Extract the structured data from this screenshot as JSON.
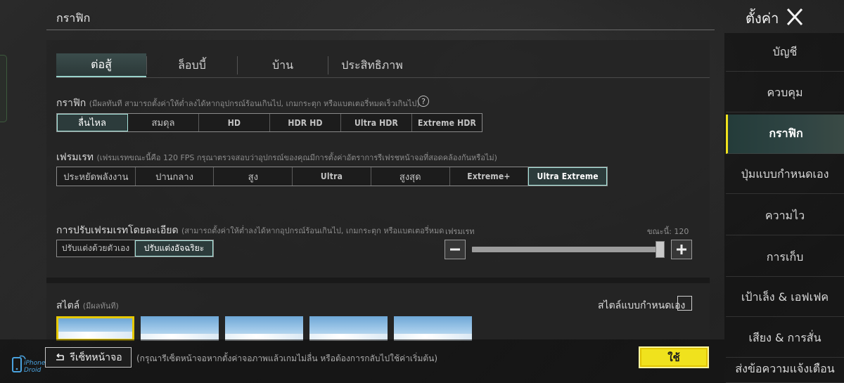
{
  "header": {
    "section_title": "กราฟิก",
    "settings_title": "ตั้งค่า",
    "close_icon": "close-icon"
  },
  "tabs": [
    {
      "label": "ต่อสู้",
      "active": true
    },
    {
      "label": "ล็อบบี้",
      "active": false
    },
    {
      "label": "บ้าน",
      "active": false
    },
    {
      "label": "ประสิทธิภาพ",
      "active": false
    }
  ],
  "graphics": {
    "label": "กราฟิก",
    "note": "(มีผลทันที สามารถตั้งค่าให้ต่ำลงได้หากอุปกรณ์ร้อนเกินไป, เกมกระตุก หรือแบตเตอรี่หมดเร็วเกินไป)",
    "help_icon": "?",
    "options": [
      "ลื่นไหล",
      "สมดุล",
      "HD",
      "HDR HD",
      "Ultra HDR",
      "Extreme HDR"
    ],
    "selected": "ลื่นไหล"
  },
  "framerate": {
    "label": "เฟรมเรท",
    "note": "(เฟรมเรทขณะนี้คือ 120 FPS กรุณาตรวจสอบว่าอุปกรณ์ของคุณมีการตั้งค่าอัตราการรีเฟรชหน้าจอที่สอดคล้องกันหรือไม่)",
    "options": [
      "ประหยัดพลังงาน",
      "ปานกลาง",
      "สูง",
      "Ultra",
      "สูงสุด",
      "Extreme+",
      "Ultra Extreme"
    ],
    "selected": "Ultra Extreme"
  },
  "fine_tune": {
    "label": "การปรับเฟรมเรทโดยละเอียด",
    "note": "(สามารถตั้งค่าให้ต่ำลงได้หากอุปกรณ์ร้อนเกินไป, เกมกระตุก หรือแบตเตอรี่หมด",
    "options": [
      "ปรับแต่งด้วยตัวเอง",
      "ปรับแต่งอัจฉริยะ"
    ],
    "selected": "ปรับแต่งอัจฉริยะ",
    "slider_label": "เฟรมเรท",
    "current_label": "ขณะนี้: 120",
    "slider_value": 120,
    "slider_fraction": 0.96,
    "minus": "−",
    "plus": "+"
  },
  "style": {
    "label": "สไตล์",
    "note": "(มีผลทันที)",
    "custom_label": "สไตล์แบบกำหนดเอง",
    "custom_checked": false,
    "thumb_count": 5,
    "selected_index": 0
  },
  "footer": {
    "reset_icon": "reset-icon",
    "reset_label": "รีเซ็ทหน้าจอ",
    "reset_note": "(กรุณารีเซ็ตหน้าจอหากตั้งค่าจอภาพแล้วเกมไม่ลื่น หรือต้องการกลับไปใช้ค่าเริ่มต้น)",
    "apply_label": "ใช้",
    "accent": "#f0e21d"
  },
  "watermark": {
    "line1": "iPhone",
    "line2": "Droid"
  },
  "sidebar": {
    "items": [
      {
        "label": "บัญชี",
        "active": false
      },
      {
        "label": "ควบคุม",
        "active": false
      },
      {
        "label": "กราฟิก",
        "active": true
      },
      {
        "label": "ปุ่มแบบกำหนดเอง",
        "active": false
      },
      {
        "label": "ความไว",
        "active": false
      },
      {
        "label": "การเก็บ",
        "active": false
      },
      {
        "label": "เป้าเล็ง & เอฟเฟค",
        "active": false
      },
      {
        "label": "เสียง & การสั่น",
        "active": false
      },
      {
        "label": "ส่งข้อความแจ้งเตือน",
        "active": false
      }
    ]
  }
}
